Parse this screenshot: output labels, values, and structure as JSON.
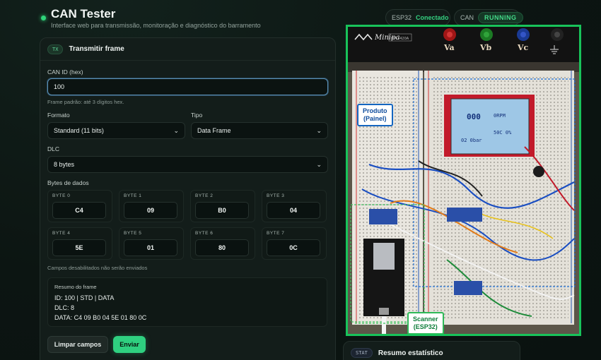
{
  "header": {
    "title": "CAN Tester",
    "subtitle": "Interface web para transmissão, monitoração e diagnóstico do barramento"
  },
  "status": {
    "esp32_label": "ESP32",
    "esp32_value": "Conectado",
    "can_label": "CAN",
    "can_value": "RUNNING"
  },
  "tx_card": {
    "badge": "TX",
    "title": "Transmitir frame",
    "can_id_label": "CAN ID (hex)",
    "can_id_value": "100",
    "can_id_hint": "Frame padrão: até 3 dígitos hex.",
    "format_label": "Formato",
    "format_value": "Standard (11 bits)",
    "type_label": "Tipo",
    "type_value": "Data Frame",
    "dlc_label": "DLC",
    "dlc_value": "8 bytes",
    "bytes_label": "Bytes de dados",
    "bytes": [
      {
        "label": "BYTE 0",
        "value": "C4"
      },
      {
        "label": "BYTE 1",
        "value": "09"
      },
      {
        "label": "BYTE 2",
        "value": "B0"
      },
      {
        "label": "BYTE 3",
        "value": "04"
      },
      {
        "label": "BYTE 4",
        "value": "5E"
      },
      {
        "label": "BYTE 5",
        "value": "01"
      },
      {
        "label": "BYTE 6",
        "value": "80"
      },
      {
        "label": "BYTE 7",
        "value": "0C"
      }
    ],
    "bytes_hint": "Campos desabilitados não serão enviados",
    "summary_title": "Resumo do frame",
    "summary_lines": [
      "ID: 100 | STD | DATA",
      "DLC: 8",
      "DATA: C4 09 B0 04 5E 01 80 0C"
    ],
    "clear_button": "Limpar campos",
    "send_button": "Enviar"
  },
  "stat_card": {
    "badge": "STAT",
    "title": "Resumo estatístico"
  },
  "photo": {
    "callout_product": [
      "Produto",
      "(Painel)"
    ],
    "callout_scanner": [
      "Scanner",
      "(ESP32)"
    ],
    "brand": "Minipa",
    "model": "MP-3420A",
    "terminals": [
      "Va",
      "Vb",
      "Vc"
    ],
    "lcd_value": "000",
    "lcd_rpm": "0RPM",
    "lcd_temp": "50C 0%",
    "lcd_pressure": "02 0bar"
  },
  "colors": {
    "accent_green": "#2fd080",
    "photo_border": "#18c35a",
    "callout_blue": "#1566c0"
  }
}
